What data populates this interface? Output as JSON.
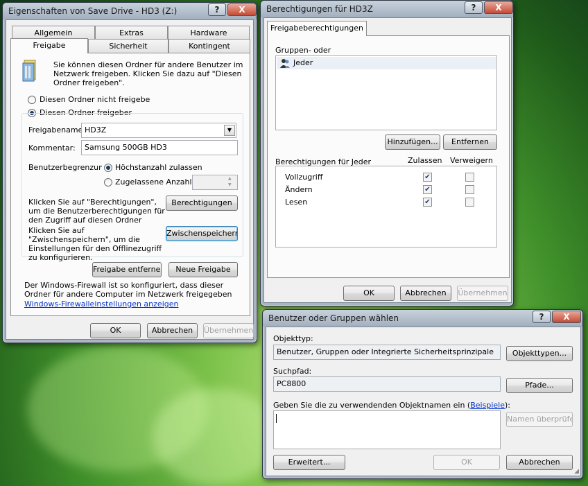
{
  "win1": {
    "title": "Eigenschaften von Save Drive - HD3 (Z:)",
    "tabs_row1": [
      "Allgemein",
      "Extras",
      "Hardware"
    ],
    "tabs_row2": [
      "Freigabe",
      "Sicherheit",
      "Kontingent"
    ],
    "intro": "Sie können diesen Ordner für andere Benutzer im Netzwerk freigeben. Klicken Sie dazu auf \"Diesen Ordner freigeben\".",
    "radio_no_share": "Diesen Ordner nicht freigebe",
    "radio_share": "Diesen Ordner freigeber",
    "share_name_label": "Freigabename",
    "share_name_value": "HD3Z",
    "comment_label": "Kommentar:",
    "comment_value": "Samsung 500GB HD3",
    "user_limit_label": "Benutzerbegrenzung",
    "radio_max": "Höchstanzahl zulassen",
    "radio_allowed": "Zugelassene Anzahl:",
    "perm_text": "Klicken Sie auf \"Berechtigungen\", um die Benutzerberechtigungen für den Zugriff auf diesen Ordner",
    "perm_button": "Berechtigungen",
    "cache_text": "Klicken Sie auf \"Zwischenspeichern\", um die Einstellungen für den Offlinezugriff zu konfigurieren.",
    "cache_button": "Zwischenspeichern",
    "remove_share": "Freigabe entfernen",
    "new_share": "Neue Freigabe",
    "firewall_text": "Der Windows-Firewall ist so konfiguriert, dass dieser Ordner für andere Computer im Netzwerk freigegeben",
    "firewall_link": "Windows-Firewalleinstellungen anzeigen",
    "ok": "OK",
    "cancel": "Abbrechen",
    "apply": "Übernehmen"
  },
  "win2": {
    "title": "Berechtigungen für HD3Z",
    "tab": "Freigabeberechtigungen",
    "groups_label": "Gruppen- oder",
    "group_item": "Jeder",
    "add": "Hinzufügen...",
    "remove": "Entfernen",
    "perm_for": "Berechtigungen für Jeder",
    "col_allow": "Zulassen",
    "col_deny": "Verweigern",
    "perms": [
      {
        "name": "Vollzugriff",
        "allow": true,
        "deny": false
      },
      {
        "name": "Ändern",
        "allow": true,
        "deny": false
      },
      {
        "name": "Lesen",
        "allow": true,
        "deny": false
      }
    ],
    "ok": "OK",
    "cancel": "Abbrechen",
    "apply": "Übernehmen"
  },
  "win3": {
    "title": "Benutzer oder Gruppen wählen",
    "objtype_label": "Objekttyp:",
    "objtype_value": "Benutzer, Gruppen oder Integrierte Sicherheitsprinzipale",
    "objtype_button": "Objekttypen...",
    "path_label": "Suchpfad:",
    "path_value": "PC8800",
    "path_button": "Pfade...",
    "names_label_pre": "Geben Sie die zu verwendenden Objektnamen ein (",
    "names_label_link": "Beispiele",
    "names_label_post": "):",
    "check_names": "Namen überprüfen",
    "advanced": "Erweitert...",
    "ok": "OK",
    "cancel": "Abbrechen"
  },
  "caption": {
    "help": "?",
    "close": "X"
  }
}
